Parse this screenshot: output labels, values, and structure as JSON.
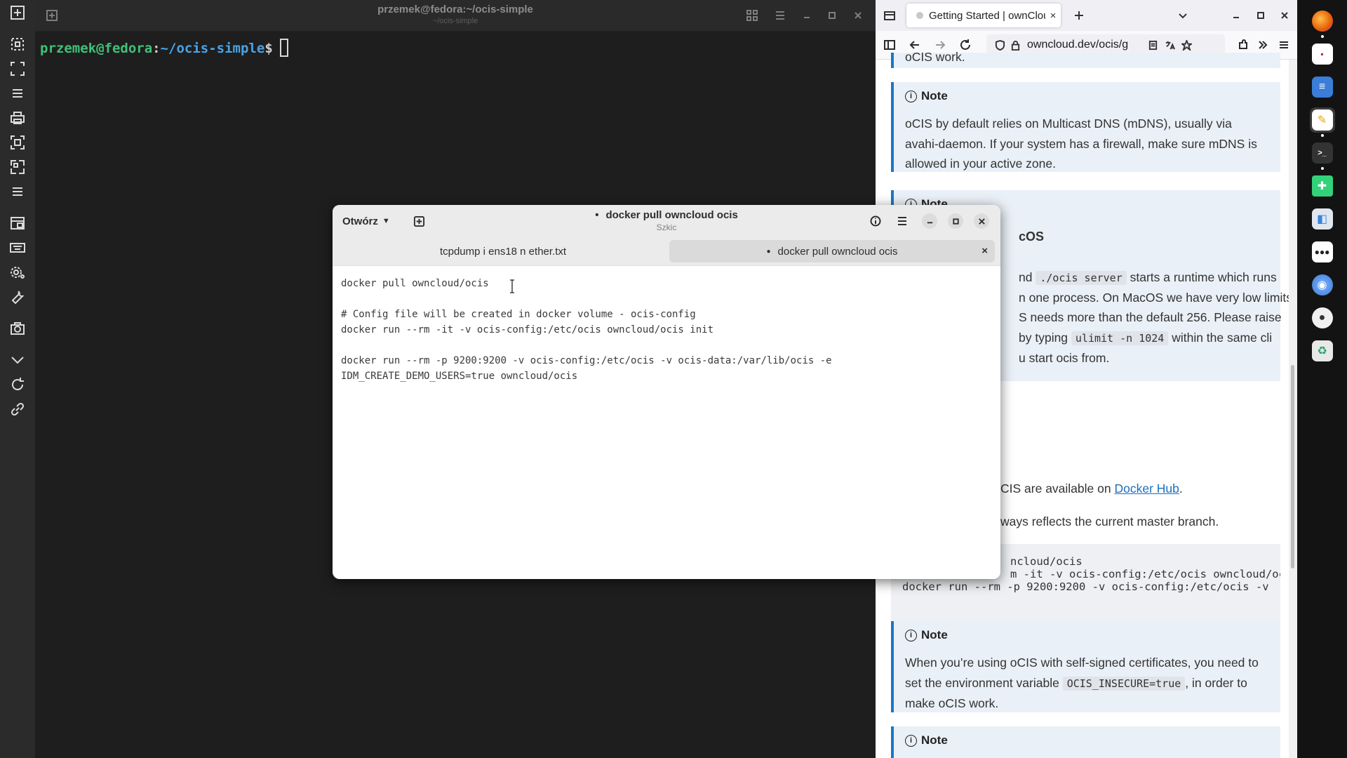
{
  "terminal": {
    "title": "przemek@fedora:~/ocis-simple",
    "subtitle": "~/ocis-simple",
    "prompt_user": "przemek@fedora",
    "prompt_colon": ":",
    "prompt_path": "~/ocis-simple",
    "prompt_symbol": "$"
  },
  "left_bar": {
    "icons": [
      "new-window-icon",
      "select-region-icon",
      "fullscreen-icon",
      "menu-icon",
      "print-icon",
      "fit-icon",
      "expand-icon",
      "list-icon",
      "window-icon",
      "keyboard-icon",
      "settings-icon",
      "wrench-icon",
      "camera-icon",
      "chevron-down-icon",
      "refresh-icon",
      "link-icon"
    ]
  },
  "browser": {
    "tab_title": "Getting Started | ownCloud",
    "url": "owncloud.dev/ocis/g",
    "notes": [
      {
        "label": "Note",
        "text": "oCIS by default relies on Multicast DNS (mDNS), usually via avahi-daemon. If your system has a firewall, make sure mDNS is allowed in your active zone."
      },
      {
        "label": "Note"
      },
      {
        "label": "Note",
        "text_before": "When you’re using oCIS with self-signed certificates, you need to set the environment variable ",
        "code": "OCIS_INSECURE=true",
        "text_after": ", in order to make oCIS work."
      },
      {
        "label": "Note"
      }
    ],
    "top_cut_text": "oCIS work.",
    "macos_heading": "cOS",
    "paragraph": {
      "line1_a": "nd ",
      "line1_code": "./ocis server",
      "line1_b": " starts a runtime which runs",
      "line2": "n one process. On MacOS we have very low limits",
      "line3": "S needs more than the default 256. Please raise",
      "line4_a": "by typing ",
      "line4_code": "ulimit -n 1024",
      "line4_b": " within the same cli",
      "line5": "u start ocis from."
    },
    "docker_line_a": "CIS are available on ",
    "docker_link": "Docker Hub",
    "docker_line_b": ".",
    "master_line": "ways reflects the current master branch.",
    "code_lines": [
      "ncloud/ocis",
      "m -it -v ocis-config:/etc/ocis owncloud/oc",
      "docker run --rm -p 9200:9200 -v ocis-config:/etc/ocis -v"
    ]
  },
  "editor": {
    "open_label": "Otwórz",
    "title": "docker pull owncloud ocis",
    "title_dot": "•",
    "subtitle": "Szkic",
    "tabs": [
      {
        "label": "tcpdump i ens18 n ether.txt"
      },
      {
        "label": "docker pull owncloud ocis",
        "modified_dot": "●",
        "close": "×"
      }
    ],
    "lines": [
      "docker pull owncloud/ocis",
      "",
      "# Config file will be created in docker volume - ocis-config",
      "docker run --rm -it -v ocis-config:/etc/ocis owncloud/ocis init",
      "",
      "docker run --rm -p 9200:9200 -v ocis-config:/etc/ocis -v ocis-data:/var/lib/ocis -e",
      "IDM_CREATE_DEMO_USERS=true owncloud/ocis"
    ]
  },
  "dock": {
    "apps": [
      {
        "name": "firefox",
        "color": "#e66000"
      },
      {
        "name": "calendar",
        "color": "#ffffff"
      },
      {
        "name": "document-viewer",
        "color": "#3b7dd8"
      },
      {
        "name": "text-editor",
        "color": "#f6d32d"
      },
      {
        "name": "terminal",
        "color": "#333333"
      },
      {
        "name": "extensions",
        "color": "#33d17a"
      },
      {
        "name": "software",
        "color": "#3584e4"
      },
      {
        "name": "apps-grid",
        "color": "#ffffff"
      },
      {
        "name": "browser-2",
        "color": "#3a7bd5"
      },
      {
        "name": "disk",
        "color": "#ffffff"
      },
      {
        "name": "recycle",
        "color": "#26a269"
      }
    ]
  }
}
